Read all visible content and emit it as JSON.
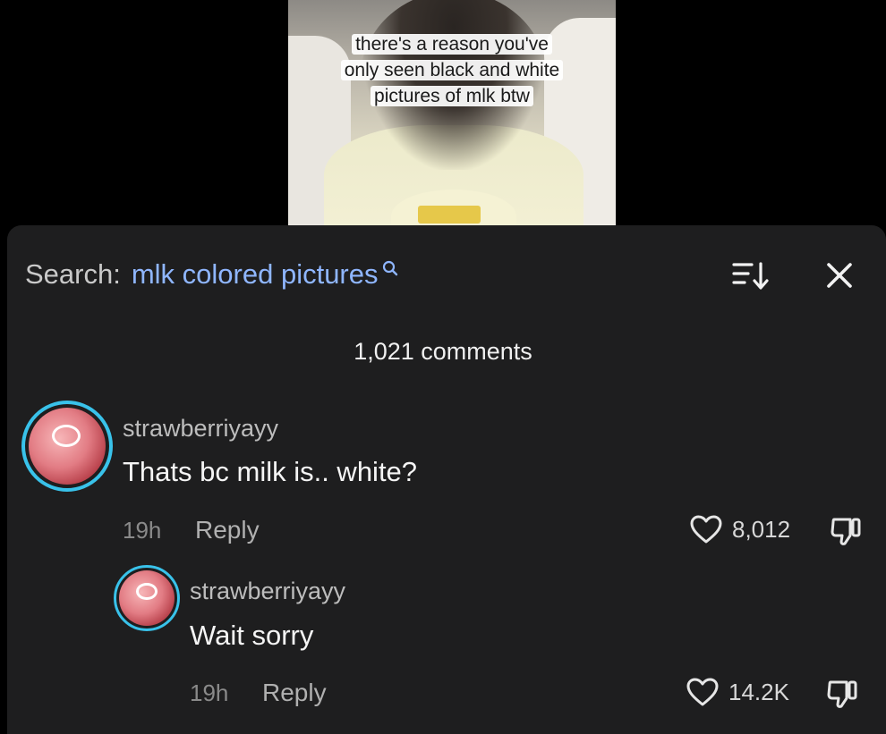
{
  "video": {
    "caption_lines": [
      "there's a reason you've",
      "only seen black and white",
      "pictures of mlk btw"
    ]
  },
  "header": {
    "search_label": "Search:",
    "search_query": "mlk colored pictures"
  },
  "comments_count": "1,021 comments",
  "comments": [
    {
      "username": "strawberriyayy",
      "text": "Thats bc milk is.. white?",
      "time": "19h",
      "reply_label": "Reply",
      "likes": "8,012"
    },
    {
      "username": "strawberriyayy",
      "text": "Wait sorry",
      "time": "19h",
      "reply_label": "Reply",
      "likes": "14.2K"
    }
  ],
  "colors": {
    "search_query": "#8fb6ff",
    "avatar_ring": "#39c2ea",
    "sheet_background": "#1e1e1f"
  },
  "icons": [
    "search-icon",
    "sort-icon",
    "close-icon",
    "heart-icon",
    "dislike-icon"
  ]
}
